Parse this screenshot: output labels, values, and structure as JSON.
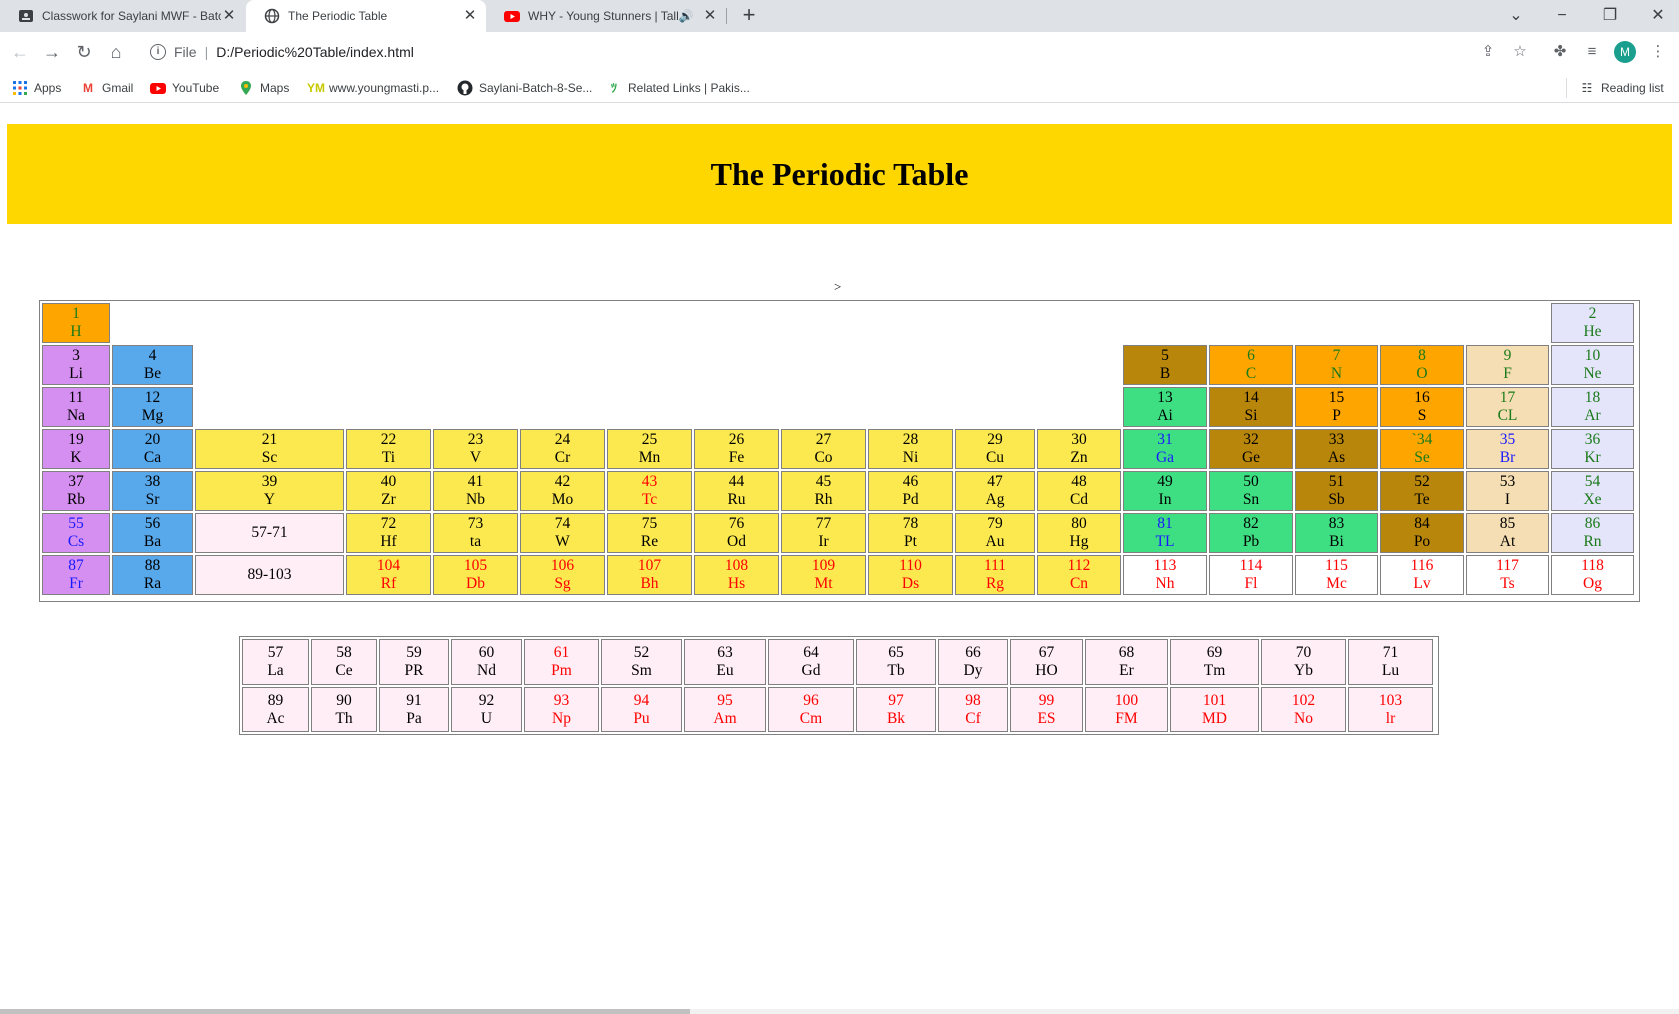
{
  "browser": {
    "tabs": [
      {
        "title": "Classwork for Saylani MWF - Batc",
        "icon": "classroom-icon",
        "active": false
      },
      {
        "title": "The Periodic Table",
        "icon": "globe-icon",
        "active": true
      },
      {
        "title": "WHY - Young Stunners | Talh",
        "icon": "youtube-icon",
        "active": false
      }
    ],
    "new_tab_label": "+",
    "omnibox": {
      "scheme": "File",
      "url": "D:/Periodic%20Table/index.html"
    },
    "avatar_letter": "M",
    "bookmarks": [
      {
        "label": "Apps",
        "icon": "apps-grid-icon"
      },
      {
        "label": "Gmail",
        "icon": "gmail-icon"
      },
      {
        "label": "YouTube",
        "icon": "youtube-icon"
      },
      {
        "label": "Maps",
        "icon": "maps-pin-icon"
      },
      {
        "label": "www.youngmasti.p...",
        "icon": "ym-icon"
      },
      {
        "label": "Saylani-Batch-8-Se...",
        "icon": "github-icon"
      },
      {
        "label": "Related Links | Pakis...",
        "icon": "link-icon"
      }
    ],
    "reading_list": "Reading list"
  },
  "page": {
    "title": "The Periodic Table",
    "stray_text": ">",
    "colors": {
      "banner": "#ffd700",
      "alkali": "#d48ff0",
      "alkaline": "#58a8ec",
      "transition": "#fbe94f",
      "metalloid": "#b8860b",
      "nonmetal": "#ffa500",
      "halogen": "#f5deb3",
      "noble": "#e4e4fa",
      "post_transition": "#3ede82",
      "lanthanide": "#ffeef5",
      "unknown": "#ffffff",
      "text_default": "#000000",
      "text_green": "#1a7a1a",
      "text_blue": "#1a1aff",
      "text_red": "#ff0000"
    },
    "main_rows": [
      [
        {
          "n": "1",
          "s": "H",
          "bg": "nonmetal",
          "tc": "green",
          "c": 0
        }
      ],
      [
        {
          "n": "3",
          "s": "Li",
          "bg": "alkali",
          "tc": "default",
          "c": 0
        },
        {
          "n": "4",
          "s": "Be",
          "bg": "alkaline",
          "tc": "default",
          "c": 1
        },
        {
          "n": "5",
          "s": "B",
          "bg": "metalloid",
          "tc": "default",
          "c": 12
        },
        {
          "n": "6",
          "s": "C",
          "bg": "nonmetal",
          "tc": "green",
          "c": 13
        },
        {
          "n": "7",
          "s": "N",
          "bg": "nonmetal",
          "tc": "green",
          "c": 14
        },
        {
          "n": "8",
          "s": "O",
          "bg": "nonmetal",
          "tc": "green",
          "c": 15
        },
        {
          "n": "9",
          "s": "F",
          "bg": "halogen",
          "tc": "green",
          "c": 16
        },
        {
          "n": "10",
          "s": "Ne",
          "bg": "noble",
          "tc": "green",
          "c": 17
        }
      ],
      [
        {
          "n": "11",
          "s": "Na",
          "bg": "alkali",
          "tc": "default",
          "c": 0
        },
        {
          "n": "12",
          "s": "Mg",
          "bg": "alkaline",
          "tc": "default",
          "c": 1
        },
        {
          "n": "13",
          "s": "Ai",
          "bg": "post_transition",
          "tc": "default",
          "c": 12
        },
        {
          "n": "14",
          "s": "Si",
          "bg": "metalloid",
          "tc": "default",
          "c": 13
        },
        {
          "n": "15",
          "s": "P",
          "bg": "nonmetal",
          "tc": "default",
          "c": 14
        },
        {
          "n": "16",
          "s": "S",
          "bg": "nonmetal",
          "tc": "default",
          "c": 15
        },
        {
          "n": "17",
          "s": "CL",
          "bg": "halogen",
          "tc": "green",
          "c": 16
        },
        {
          "n": "18",
          "s": "Ar",
          "bg": "noble",
          "tc": "green",
          "c": 17
        }
      ],
      [
        {
          "n": "19",
          "s": "K",
          "bg": "alkali",
          "tc": "default",
          "c": 0
        },
        {
          "n": "20",
          "s": "Ca",
          "bg": "alkaline",
          "tc": "default",
          "c": 1
        },
        {
          "n": "21",
          "s": "Sc",
          "bg": "transition",
          "tc": "default",
          "c": 2
        },
        {
          "n": "22",
          "s": "Ti",
          "bg": "transition",
          "tc": "default",
          "c": 3
        },
        {
          "n": "23",
          "s": "V",
          "bg": "transition",
          "tc": "default",
          "c": 4
        },
        {
          "n": "24",
          "s": "Cr",
          "bg": "transition",
          "tc": "default",
          "c": 5
        },
        {
          "n": "25",
          "s": "Mn",
          "bg": "transition",
          "tc": "default",
          "c": 6
        },
        {
          "n": "26",
          "s": "Fe",
          "bg": "transition",
          "tc": "default",
          "c": 7
        },
        {
          "n": "27",
          "s": "Co",
          "bg": "transition",
          "tc": "default",
          "c": 8
        },
        {
          "n": "28",
          "s": "Ni",
          "bg": "transition",
          "tc": "default",
          "c": 9
        },
        {
          "n": "29",
          "s": "Cu",
          "bg": "transition",
          "tc": "default",
          "c": 10
        },
        {
          "n": "30",
          "s": "Zn",
          "bg": "transition",
          "tc": "default",
          "c": 11
        },
        {
          "n": "31",
          "s": "Ga",
          "bg": "post_transition",
          "tc": "blue",
          "c": 12
        },
        {
          "n": "32",
          "s": "Ge",
          "bg": "metalloid",
          "tc": "default",
          "c": 13
        },
        {
          "n": "33",
          "s": "As",
          "bg": "metalloid",
          "tc": "default",
          "c": 14
        },
        {
          "n": "`34",
          "s": "Se",
          "bg": "nonmetal",
          "tc": "green",
          "c": 15
        },
        {
          "n": "35",
          "s": "Br",
          "bg": "halogen",
          "tc": "blue",
          "c": 16
        },
        {
          "n": "36",
          "s": "Kr",
          "bg": "noble",
          "tc": "green",
          "c": 17
        }
      ],
      [
        {
          "n": "37",
          "s": "Rb",
          "bg": "alkali",
          "tc": "default",
          "c": 0
        },
        {
          "n": "38",
          "s": "Sr",
          "bg": "alkaline",
          "tc": "default",
          "c": 1
        },
        {
          "n": "39",
          "s": "Y",
          "bg": "transition",
          "tc": "default",
          "c": 2
        },
        {
          "n": "40",
          "s": "Zr",
          "bg": "transition",
          "tc": "default",
          "c": 3
        },
        {
          "n": "41",
          "s": "Nb",
          "bg": "transition",
          "tc": "default",
          "c": 4
        },
        {
          "n": "42",
          "s": "Mo",
          "bg": "transition",
          "tc": "default",
          "c": 5
        },
        {
          "n": "43",
          "s": "Tc",
          "bg": "transition",
          "tc": "red",
          "c": 6
        },
        {
          "n": "44",
          "s": "Ru",
          "bg": "transition",
          "tc": "default",
          "c": 7
        },
        {
          "n": "45",
          "s": "Rh",
          "bg": "transition",
          "tc": "default",
          "c": 8
        },
        {
          "n": "46",
          "s": "Pd",
          "bg": "transition",
          "tc": "default",
          "c": 9
        },
        {
          "n": "47",
          "s": "Ag",
          "bg": "transition",
          "tc": "default",
          "c": 10
        },
        {
          "n": "48",
          "s": "Cd",
          "bg": "transition",
          "tc": "default",
          "c": 11
        },
        {
          "n": "49",
          "s": "In",
          "bg": "post_transition",
          "tc": "default",
          "c": 12
        },
        {
          "n": "50",
          "s": "Sn",
          "bg": "post_transition",
          "tc": "default",
          "c": 13
        },
        {
          "n": "51",
          "s": "Sb",
          "bg": "metalloid",
          "tc": "default",
          "c": 14
        },
        {
          "n": "52",
          "s": "Te",
          "bg": "metalloid",
          "tc": "default",
          "c": 15
        },
        {
          "n": "53",
          "s": "I",
          "bg": "halogen",
          "tc": "default",
          "c": 16
        },
        {
          "n": "54",
          "s": "Xe",
          "bg": "noble",
          "tc": "green",
          "c": 17
        }
      ],
      [
        {
          "n": "55",
          "s": "Cs",
          "bg": "alkali",
          "tc": "blue",
          "c": 0
        },
        {
          "n": "56",
          "s": "Ba",
          "bg": "alkaline",
          "tc": "default",
          "c": 1
        },
        {
          "n": "57-71",
          "s": "",
          "bg": "lanthanide",
          "tc": "default",
          "c": 2
        },
        {
          "n": "72",
          "s": "Hf",
          "bg": "transition",
          "tc": "default",
          "c": 3
        },
        {
          "n": "73",
          "s": "ta",
          "bg": "transition",
          "tc": "default",
          "c": 4
        },
        {
          "n": "74",
          "s": "W",
          "bg": "transition",
          "tc": "default",
          "c": 5
        },
        {
          "n": "75",
          "s": "Re",
          "bg": "transition",
          "tc": "default",
          "c": 6
        },
        {
          "n": "76",
          "s": "Od",
          "bg": "transition",
          "tc": "default",
          "c": 7
        },
        {
          "n": "77",
          "s": "Ir",
          "bg": "transition",
          "tc": "default",
          "c": 8
        },
        {
          "n": "78",
          "s": "Pt",
          "bg": "transition",
          "tc": "default",
          "c": 9
        },
        {
          "n": "79",
          "s": "Au",
          "bg": "transition",
          "tc": "default",
          "c": 10
        },
        {
          "n": "80",
          "s": "Hg",
          "bg": "transition",
          "tc": "default",
          "c": 11
        },
        {
          "n": "81",
          "s": "TL",
          "bg": "post_transition",
          "tc": "blue",
          "c": 12
        },
        {
          "n": "82",
          "s": "Pb",
          "bg": "post_transition",
          "tc": "default",
          "c": 13
        },
        {
          "n": "83",
          "s": "Bi",
          "bg": "post_transition",
          "tc": "default",
          "c": 14
        },
        {
          "n": "84",
          "s": "Po",
          "bg": "metalloid",
          "tc": "default",
          "c": 15
        },
        {
          "n": "85",
          "s": "At",
          "bg": "halogen",
          "tc": "default",
          "c": 16
        },
        {
          "n": "86",
          "s": "Rn",
          "bg": "noble",
          "tc": "green",
          "c": 17
        }
      ],
      [
        {
          "n": "87",
          "s": "Fr",
          "bg": "alkali",
          "tc": "blue",
          "c": 0
        },
        {
          "n": "88",
          "s": "Ra",
          "bg": "alkaline",
          "tc": "default",
          "c": 1
        },
        {
          "n": "89-103",
          "s": "",
          "bg": "lanthanide",
          "tc": "default",
          "c": 2
        },
        {
          "n": "104",
          "s": "Rf",
          "bg": "transition",
          "tc": "red",
          "c": 3
        },
        {
          "n": "105",
          "s": "Db",
          "bg": "transition",
          "tc": "red",
          "c": 4
        },
        {
          "n": "106",
          "s": "Sg",
          "bg": "transition",
          "tc": "red",
          "c": 5
        },
        {
          "n": "107",
          "s": "Bh",
          "bg": "transition",
          "tc": "red",
          "c": 6
        },
        {
          "n": "108",
          "s": "Hs",
          "bg": "transition",
          "tc": "red",
          "c": 7
        },
        {
          "n": "109",
          "s": "Mt",
          "bg": "transition",
          "tc": "red",
          "c": 8
        },
        {
          "n": "110",
          "s": "Ds",
          "bg": "transition",
          "tc": "red",
          "c": 9
        },
        {
          "n": "111",
          "s": "Rg",
          "bg": "transition",
          "tc": "red",
          "c": 10
        },
        {
          "n": "112",
          "s": "Cn",
          "bg": "transition",
          "tc": "red",
          "c": 11
        },
        {
          "n": "113",
          "s": "Nh",
          "bg": "unknown",
          "tc": "red",
          "c": 12
        },
        {
          "n": "114",
          "s": "Fl",
          "bg": "unknown",
          "tc": "red",
          "c": 13
        },
        {
          "n": "115",
          "s": "Mc",
          "bg": "unknown",
          "tc": "red",
          "c": 14
        },
        {
          "n": "116",
          "s": "Lv",
          "bg": "unknown",
          "tc": "red",
          "c": 15
        },
        {
          "n": "117",
          "s": "Ts",
          "bg": "unknown",
          "tc": "red",
          "c": 16
        },
        {
          "n": "118",
          "s": "Og",
          "bg": "unknown",
          "tc": "red",
          "c": 17
        }
      ]
    ],
    "extra_cell": {
      "n": "2",
      "s": "He",
      "bg": "noble",
      "tc": "green",
      "c": 17,
      "r": 0
    },
    "lanthanide_rows": [
      [
        {
          "n": "57",
          "s": "La",
          "tc": "default"
        },
        {
          "n": "58",
          "s": "Ce",
          "tc": "default"
        },
        {
          "n": "59",
          "s": "PR",
          "tc": "default"
        },
        {
          "n": "60",
          "s": "Nd",
          "tc": "default"
        },
        {
          "n": "61",
          "s": "Pm",
          "tc": "red"
        },
        {
          "n": "52",
          "s": "Sm",
          "tc": "default"
        },
        {
          "n": "63",
          "s": "Eu",
          "tc": "default"
        },
        {
          "n": "64",
          "s": "Gd",
          "tc": "default"
        },
        {
          "n": "65",
          "s": "Tb",
          "tc": "default"
        },
        {
          "n": "66",
          "s": "Dy",
          "tc": "default"
        },
        {
          "n": "67",
          "s": "HO",
          "tc": "default"
        },
        {
          "n": "68",
          "s": "Er",
          "tc": "default"
        },
        {
          "n": "69",
          "s": "Tm",
          "tc": "default"
        },
        {
          "n": "70",
          "s": "Yb",
          "tc": "default"
        },
        {
          "n": "71",
          "s": "Lu",
          "tc": "default"
        }
      ],
      [
        {
          "n": "89",
          "s": "Ac",
          "tc": "default"
        },
        {
          "n": "90",
          "s": "Th",
          "tc": "default"
        },
        {
          "n": "91",
          "s": "Pa",
          "tc": "default"
        },
        {
          "n": "92",
          "s": "U",
          "tc": "default"
        },
        {
          "n": "93",
          "s": "Np",
          "tc": "red"
        },
        {
          "n": "94",
          "s": "Pu",
          "tc": "red"
        },
        {
          "n": "95",
          "s": "Am",
          "tc": "red"
        },
        {
          "n": "96",
          "s": "Cm",
          "tc": "red"
        },
        {
          "n": "97",
          "s": "Bk",
          "tc": "red"
        },
        {
          "n": "98",
          "s": "Cf",
          "tc": "red"
        },
        {
          "n": "99",
          "s": "ES",
          "tc": "red"
        },
        {
          "n": "100",
          "s": "FM",
          "tc": "red"
        },
        {
          "n": "101",
          "s": "MD",
          "tc": "red"
        },
        {
          "n": "102",
          "s": "No",
          "tc": "red"
        },
        {
          "n": "103",
          "s": "lr",
          "tc": "red"
        }
      ]
    ]
  }
}
